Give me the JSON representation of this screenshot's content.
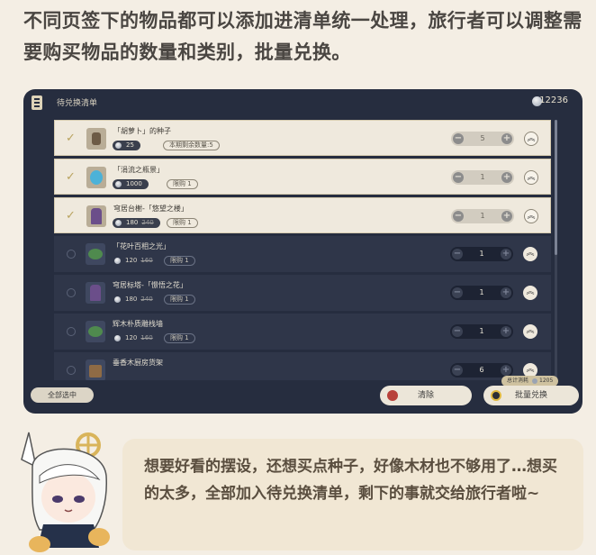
{
  "intro_text": "不同页签下的物品都可以添加进清单统一处理，旅行者可以调整需要购买物品的数量和类别，批量兑换。",
  "panel": {
    "title": "待兑换清单",
    "balance": "12236"
  },
  "items": [
    {
      "name": "「胡萝卜」的种子",
      "price": "25",
      "original_price": "",
      "limit": "本期剩余数量:5",
      "qty": "5",
      "selected": true
    },
    {
      "name": "「涓流之瓶景」",
      "price": "1000",
      "original_price": "",
      "limit": "限购 1",
      "qty": "1",
      "selected": true
    },
    {
      "name": "穹居台榭-「悠望之楼」",
      "price": "180",
      "original_price": "240",
      "limit": "限购 1",
      "qty": "1",
      "selected": true
    },
    {
      "name": "「花叶百相之光」",
      "price": "120",
      "original_price": "160",
      "limit": "限购 1",
      "qty": "1",
      "selected": false
    },
    {
      "name": "穹居标塔-「憬悟之花」",
      "price": "180",
      "original_price": "240",
      "limit": "限购 1",
      "qty": "1",
      "selected": false
    },
    {
      "name": "辉木朴质雕栈墙",
      "price": "120",
      "original_price": "160",
      "limit": "限购 1",
      "qty": "1",
      "selected": false
    },
    {
      "name": "垂香木厨房货架",
      "price": "",
      "original_price": "",
      "limit": "",
      "qty": "6",
      "selected": false
    }
  ],
  "footer": {
    "select_all": "全部选中",
    "clear": "清除",
    "total_label": "总计消耗",
    "total_value": "1205",
    "redeem": "批量兑换"
  },
  "bubble_text": "想要好看的摆设，还想买点种子，好像木材也不够用了…想买的太多，全部加入待兑换清单，剩下的事就交给旅行者啦~",
  "icons": {
    "list": "list-icon",
    "currency": "coin-icon",
    "check": "check-icon",
    "minus": "minus-icon",
    "plus": "plus-icon",
    "expand": "double-chevron-up-icon",
    "clear": "clear-icon",
    "redeem": "redeem-icon"
  }
}
